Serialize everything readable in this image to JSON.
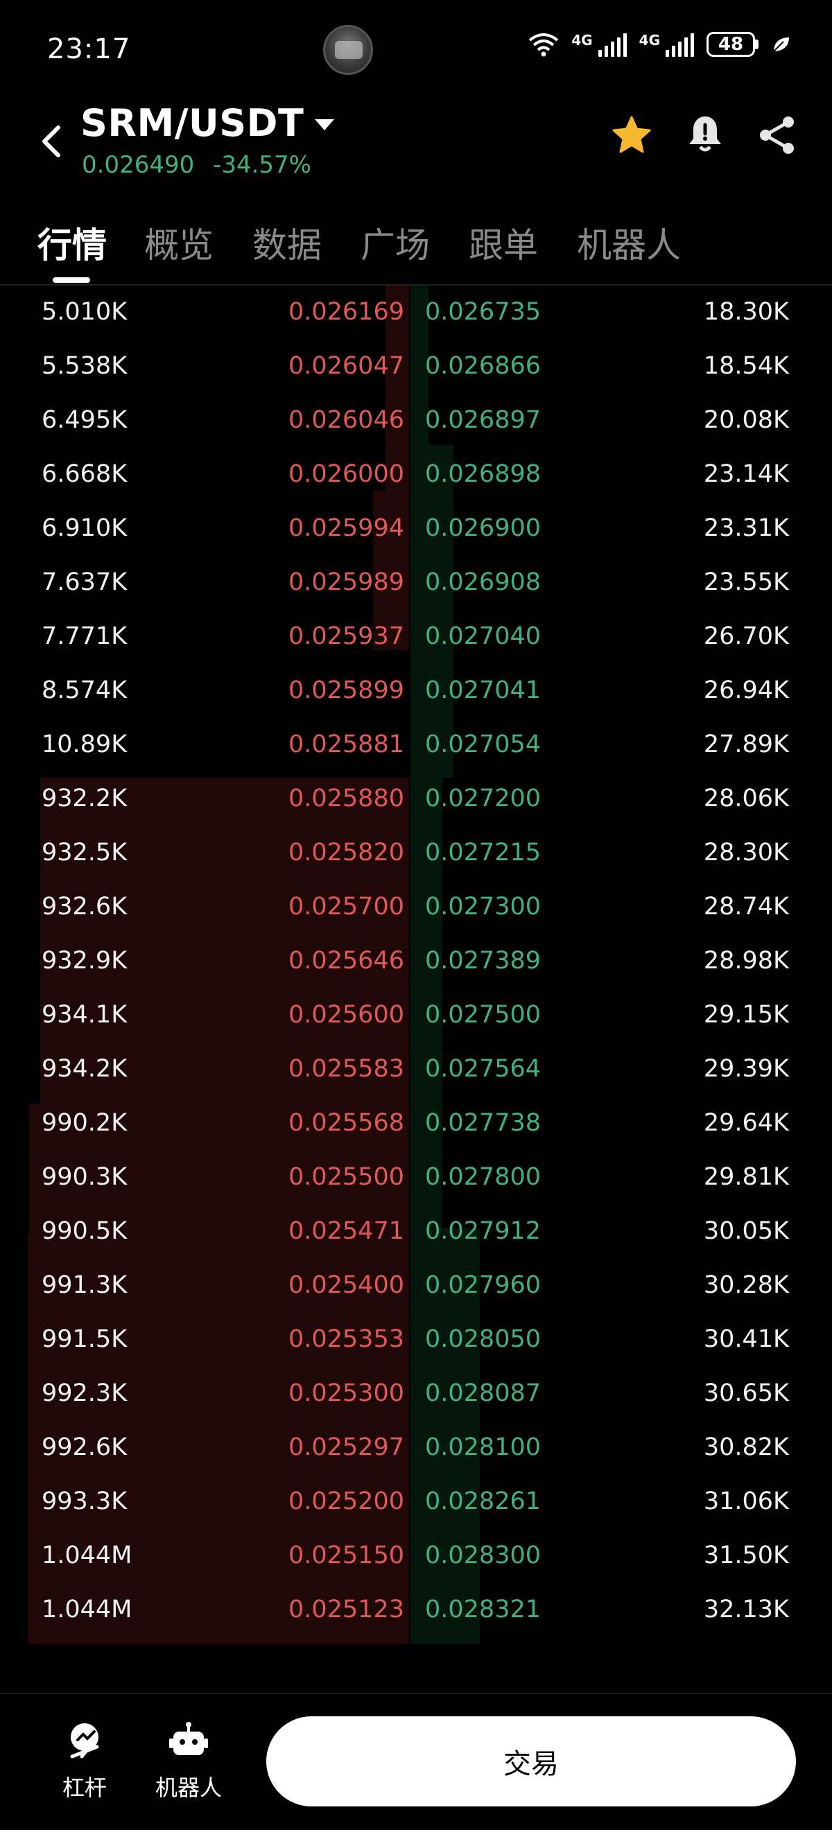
{
  "status_bar": {
    "time": "23:17",
    "network_1": "4G",
    "network_2": "4G",
    "battery": "48"
  },
  "header": {
    "pair": "SRM/USDT",
    "last_price": "0.026490",
    "change_pct": "-34.57%",
    "accent_green": "#3fb27f",
    "accent_red": "#e0585a",
    "star_color": "#f5b82e"
  },
  "tabs": [
    {
      "label": "行情",
      "active": true
    },
    {
      "label": "概览",
      "active": false
    },
    {
      "label": "数据",
      "active": false
    },
    {
      "label": "广场",
      "active": false
    },
    {
      "label": "跟单",
      "active": false
    },
    {
      "label": "机器人",
      "active": false
    }
  ],
  "order_book": [
    {
      "bid_qty": "5.010K",
      "bid_price": "0.026169",
      "ask_price": "0.026735",
      "ask_qty": "18.30K"
    },
    {
      "bid_qty": "5.538K",
      "bid_price": "0.026047",
      "ask_price": "0.026866",
      "ask_qty": "18.54K"
    },
    {
      "bid_qty": "6.495K",
      "bid_price": "0.026046",
      "ask_price": "0.026897",
      "ask_qty": "20.08K"
    },
    {
      "bid_qty": "6.668K",
      "bid_price": "0.026000",
      "ask_price": "0.026898",
      "ask_qty": "23.14K"
    },
    {
      "bid_qty": "6.910K",
      "bid_price": "0.025994",
      "ask_price": "0.026900",
      "ask_qty": "23.31K"
    },
    {
      "bid_qty": "7.637K",
      "bid_price": "0.025989",
      "ask_price": "0.026908",
      "ask_qty": "23.55K"
    },
    {
      "bid_qty": "7.771K",
      "bid_price": "0.025937",
      "ask_price": "0.027040",
      "ask_qty": "26.70K"
    },
    {
      "bid_qty": "8.574K",
      "bid_price": "0.025899",
      "ask_price": "0.027041",
      "ask_qty": "26.94K"
    },
    {
      "bid_qty": "10.89K",
      "bid_price": "0.025881",
      "ask_price": "0.027054",
      "ask_qty": "27.89K"
    },
    {
      "bid_qty": "932.2K",
      "bid_price": "0.025880",
      "ask_price": "0.027200",
      "ask_qty": "28.06K"
    },
    {
      "bid_qty": "932.5K",
      "bid_price": "0.025820",
      "ask_price": "0.027215",
      "ask_qty": "28.30K"
    },
    {
      "bid_qty": "932.6K",
      "bid_price": "0.025700",
      "ask_price": "0.027300",
      "ask_qty": "28.74K"
    },
    {
      "bid_qty": "932.9K",
      "bid_price": "0.025646",
      "ask_price": "0.027389",
      "ask_qty": "28.98K"
    },
    {
      "bid_qty": "934.1K",
      "bid_price": "0.025600",
      "ask_price": "0.027500",
      "ask_qty": "29.15K"
    },
    {
      "bid_qty": "934.2K",
      "bid_price": "0.025583",
      "ask_price": "0.027564",
      "ask_qty": "29.39K"
    },
    {
      "bid_qty": "990.2K",
      "bid_price": "0.025568",
      "ask_price": "0.027738",
      "ask_qty": "29.64K"
    },
    {
      "bid_qty": "990.3K",
      "bid_price": "0.025500",
      "ask_price": "0.027800",
      "ask_qty": "29.81K"
    },
    {
      "bid_qty": "990.5K",
      "bid_price": "0.025471",
      "ask_price": "0.027912",
      "ask_qty": "30.05K"
    },
    {
      "bid_qty": "991.3K",
      "bid_price": "0.025400",
      "ask_price": "0.027960",
      "ask_qty": "30.28K"
    },
    {
      "bid_qty": "991.5K",
      "bid_price": "0.025353",
      "ask_price": "0.028050",
      "ask_qty": "30.41K"
    },
    {
      "bid_qty": "992.3K",
      "bid_price": "0.025300",
      "ask_price": "0.028087",
      "ask_qty": "30.65K"
    },
    {
      "bid_qty": "992.6K",
      "bid_price": "0.025297",
      "ask_price": "0.028100",
      "ask_qty": "30.82K"
    },
    {
      "bid_qty": "993.3K",
      "bid_price": "0.025200",
      "ask_price": "0.028261",
      "ask_qty": "31.06K"
    },
    {
      "bid_qty": "1.044M",
      "bid_price": "0.025150",
      "ask_price": "0.028300",
      "ask_qty": "31.50K"
    },
    {
      "bid_qty": "1.044M",
      "bid_price": "0.025123",
      "ask_price": "0.028321",
      "ask_qty": "32.13K"
    }
  ],
  "bottom_bar": {
    "leverage_label": "杠杆",
    "bot_label": "机器人",
    "trade_label": "交易"
  }
}
